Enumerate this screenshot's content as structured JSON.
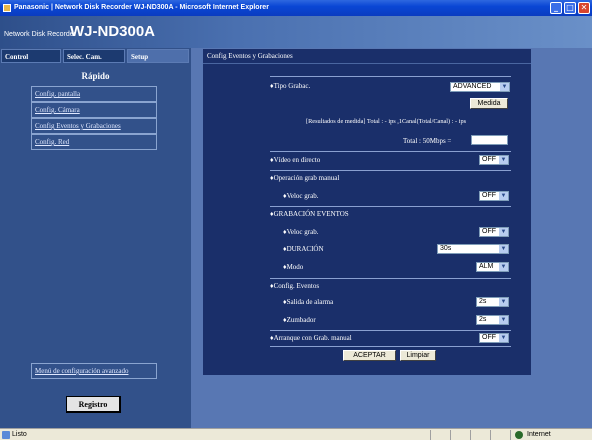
{
  "window": {
    "title": "Panasonic | Network Disk Recorder WJ-ND300A - Microsoft Internet Explorer",
    "minimize": "_",
    "maximize": "□",
    "close": "✕"
  },
  "header": {
    "brand_small": "Network Disk Recorder",
    "brand_model": "WJ-ND300A"
  },
  "tabs": [
    "Control",
    "Selec. Cam.",
    "Setup"
  ],
  "sidebar": {
    "section_title": "Rápido",
    "items": [
      {
        "label": "Config. pantalla"
      },
      {
        "label": "Config. Cámara"
      },
      {
        "label": "Config Eventos y Grabaciones"
      },
      {
        "label": "Config. Red"
      }
    ],
    "advanced_link": "Menú de configuración avanzado",
    "login_button": "Registro"
  },
  "content": {
    "header": "Config Eventos y Grabaciones",
    "tipo_grabac": {
      "label": "♦Tipo Grabac.",
      "value": "ADVANCED"
    },
    "medida_button": "Medida",
    "resultados_text": "[Resultados de medida] Total : - ips ,1Canal(Total/Canal) : - ips",
    "total_label": "Total : 50Mbps  =",
    "video_directo": {
      "label": "♦Vídeo en directo",
      "value": "OFF"
    },
    "operacion_manual": {
      "label": "♦Operación grab manual"
    },
    "veloc_grab_manual": {
      "label": "♦Veloc grab.",
      "value": "OFF"
    },
    "grabacion_eventos": {
      "label": "♦GRABACIÓN EVENTOS"
    },
    "veloc_grab_eventos": {
      "label": "♦Veloc grab.",
      "value": "OFF"
    },
    "duracion": {
      "label": "♦DURACIÓN",
      "value": "30s"
    },
    "modo": {
      "label": "♦Modo",
      "value": "ALM"
    },
    "config_eventos": {
      "label": "♦Config. Eventos"
    },
    "salida_alarma": {
      "label": "♦Salida de alarma",
      "value": "2s"
    },
    "zumbador": {
      "label": "♦Zumbador",
      "value": "2s"
    },
    "arranque_manual": {
      "label": "♦Arranque con Grab. manual",
      "value": "OFF"
    },
    "accept_button": "ACEPTAR",
    "clear_button": "Limpiar"
  },
  "statusbar": {
    "left": "Listo",
    "right": "Internet"
  },
  "icons": {
    "dropdown": "chevron-down-icon",
    "ie_page": "ie-page-icon",
    "internet_zone": "globe-icon"
  }
}
